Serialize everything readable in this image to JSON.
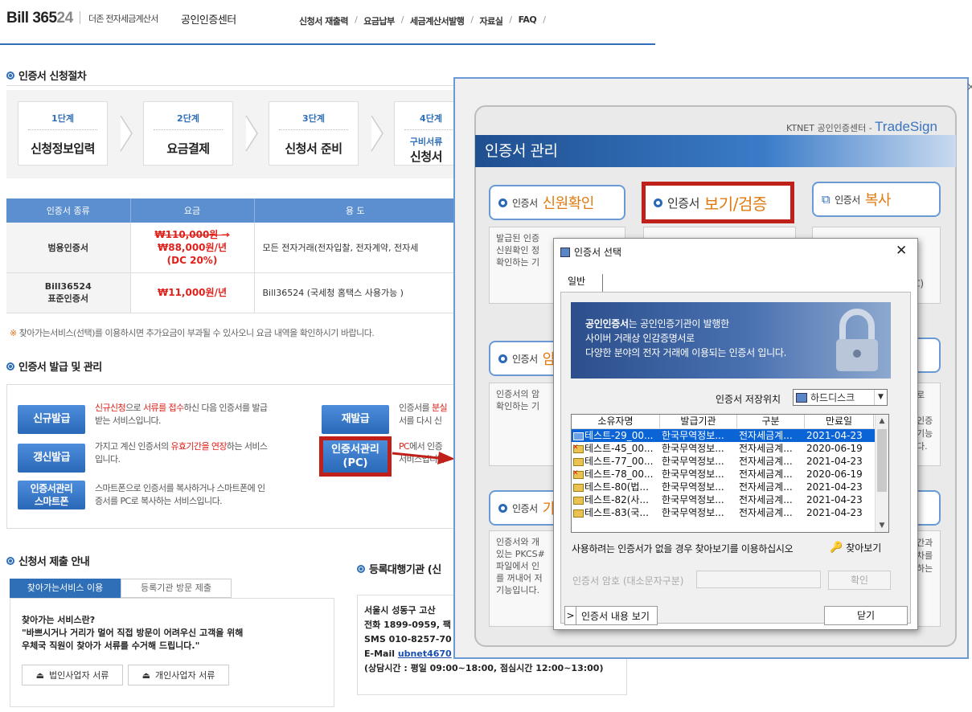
{
  "header": {
    "logo_bold": "Bill 365",
    "logo_num": "24",
    "sub1": "더존 전자세금계산서",
    "sub2": "공인인증센터",
    "nav": [
      "신청서 재출력",
      "요금납부",
      "세금계산서발행",
      "자료실",
      "FAQ"
    ]
  },
  "procedure": {
    "title": "인증서 신청절차",
    "steps": [
      {
        "label": "1단계",
        "name": "신청정보입력"
      },
      {
        "label": "2단계",
        "name": "요금결제"
      },
      {
        "label": "3단계",
        "name": "신청서 준비"
      },
      {
        "label": "4단계",
        "sub": "구비서류",
        "name": "신청서"
      }
    ]
  },
  "price_table": {
    "headers": [
      "인증서 종류",
      "요금",
      "용 도"
    ],
    "rows": [
      {
        "type": "범용인증서",
        "old_price": "₩110,000원 →",
        "price": "₩88,000원/년",
        "discount": "(DC 20%)",
        "use": "모든 전자거래(전자입찰, 전자계약, 전자세"
      },
      {
        "type_line1": "Bill36524",
        "type_line2": "표준인증서",
        "price": "₩11,000원/년",
        "use": "Bill36524 (국세청 홈택스 사용가능 )"
      }
    ]
  },
  "notice": "찾아가는서비스(선택)를 이용하시면 추가요금이 부과될 수 있사오니 요금 내역을 확인하시기 바랍니다.",
  "issue": {
    "title": "인증서 발급 및 관리",
    "new_btn": "신규발급",
    "new_desc_red1": "신규신청",
    "new_desc_1": "으로 ",
    "new_desc_red2": "서류를 접수",
    "new_desc_2": "하신 다음 인증서를 발급",
    "new_desc_3": "받는 서비스입니다.",
    "renew_btn": "갱신발급",
    "renew_desc_1": "가지고 계신 인증서의 ",
    "renew_desc_red": "유효기간을 연장",
    "renew_desc_2": "하는 서비스",
    "renew_desc_3": "입니다.",
    "smart_btn_1": "인증서관리",
    "smart_btn_2": "스마트폰",
    "smart_desc_1": "스마트폰으로 인증서를 복사하거나 스마트폰에 인",
    "smart_desc_2": "증서를 PC로 복사하는 서비스입니다.",
    "reissue_btn": "재발급",
    "reissue_desc_1": "인증서를 ",
    "reissue_desc_red": "분실",
    "reissue_desc_2": "서를 다시 신",
    "pc_btn_1": "인증서관리",
    "pc_btn_2": "(PC)",
    "pc_desc_red": "PC",
    "pc_desc_1": "에서 인증",
    "pc_desc_2": "서비스입니다"
  },
  "submission": {
    "title": "신청서 제출 안내",
    "tab_on": "찾아가는서비스 이용",
    "tab_off": "등록기관 방문 제출",
    "q": "찾아가는 서비스란?",
    "desc1": "\"바쁘시거나 거리가 멀어 직접 방문이 어려우신 고객을 위해",
    "desc2": "우체국 직원이 찾아가 서류를 수거해 드립니다.\"",
    "btn1": "법인사업자 서류",
    "btn2": "개인사업자 서류"
  },
  "agency": {
    "title": "등록대행기관 (신",
    "l1": "서울시 성동구 고산",
    "l2": "전화 1899-0959, 팩",
    "l3": "SMS 010-8257-70",
    "l4_label": "E-Mail ",
    "l4_link": "ubnet4670",
    "l5": "(상담시간 : 평일 09:00~18:00, 점심시간 12:00~13:00)"
  },
  "tradesign": {
    "brand_prefix": "KTNET 공인인증센터 - ",
    "brand": "TradeSign",
    "banner": "인증서 관리",
    "card1_small": "인증서 ",
    "card1_big": "신원확인",
    "card2_small": "인증서 ",
    "card2_big": "보기/검증",
    "card3_small": "인증서 ",
    "card3_big": "복사",
    "card1_body": [
      "발급된 인증",
      "신원확인 정",
      "확인하는 기"
    ],
    "card3_right": [
      "C)"
    ],
    "card4_small": "인증서 ",
    "card4_big": "암",
    "card4_body": [
      "인증서의 암",
      "확인하는 기"
    ],
    "card6_right": [
      "로",
      "인증",
      "기능",
      "다."
    ],
    "card7_small": "인증서 ",
    "card7_big": "가",
    "card7_body": [
      "인증서와 개",
      "있는 PKCS#",
      "파일에서 인",
      "를 꺼내어 저",
      "기능입니다."
    ],
    "card9_right": [
      "간과",
      "차를",
      "하는"
    ]
  },
  "dialog": {
    "title": "인증서 선택",
    "tab": "일반",
    "banner_bold": "공인인증서",
    "banner_1": "는 공인인증기관이 발행한",
    "banner_2": "사이버 거래상 인감증명서로",
    "banner_3": "다양한 분야의 전자 거래에 이용되는 인증서 입니다.",
    "store_label": "인증서 저장위치",
    "store_value": "하드디스크",
    "columns": [
      "소유자명",
      "발급기관",
      "구분",
      "만료일"
    ],
    "rows": [
      {
        "owner": "테스트-29_00...",
        "issuer": "한국무역정보...",
        "kind": "전자세금계...",
        "expiry": "2021-04-23",
        "selected": true,
        "expired": false
      },
      {
        "owner": "테스트-45_00...",
        "issuer": "한국무역정보...",
        "kind": "전자세금계...",
        "expiry": "2020-06-19",
        "selected": false,
        "expired": true
      },
      {
        "owner": "테스트-77_00...",
        "issuer": "한국무역정보...",
        "kind": "전자세금계...",
        "expiry": "2021-04-23",
        "selected": false,
        "expired": false
      },
      {
        "owner": "테스트-78_00...",
        "issuer": "한국무역정보...",
        "kind": "전자세금계...",
        "expiry": "2020-06-19",
        "selected": false,
        "expired": true
      },
      {
        "owner": "테스트-80(법...",
        "issuer": "한국무역정보...",
        "kind": "전자세금계...",
        "expiry": "2021-04-23",
        "selected": false,
        "expired": false
      },
      {
        "owner": "테스트-82(사...",
        "issuer": "한국무역정보...",
        "kind": "전자세금계...",
        "expiry": "2021-04-23",
        "selected": false,
        "expired": false
      },
      {
        "owner": "테스트-83(국...",
        "issuer": "한국무역정보...",
        "kind": "전자세금계...",
        "expiry": "2021-04-23",
        "selected": false,
        "expired": false
      }
    ],
    "use_msg": "사용하려는 인증서가 없을 경우 찾아보기를 이용하십시오",
    "find": "찾아보기",
    "pw_label": "인증서 암호 (대소문자구분)",
    "ok": "확인",
    "view": "인증서 내용 보기",
    "close": "닫기"
  }
}
